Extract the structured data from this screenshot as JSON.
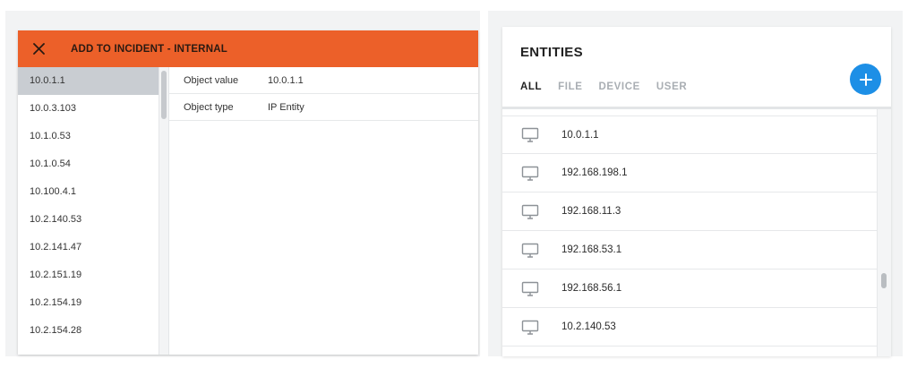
{
  "modal": {
    "title": "ADD TO INCIDENT - INTERNAL",
    "header_color": "#ec6029",
    "close_icon": "close-icon"
  },
  "ip_list": [
    "10.0.1.1",
    "10.0.3.103",
    "10.1.0.53",
    "10.1.0.54",
    "10.100.4.1",
    "10.2.140.53",
    "10.2.141.47",
    "10.2.151.19",
    "10.2.154.19",
    "10.2.154.28"
  ],
  "selected_ip": "10.0.1.1",
  "details": [
    {
      "label": "Object value",
      "value": "10.0.1.1"
    },
    {
      "label": "Object type",
      "value": "IP Entity"
    }
  ],
  "entities": {
    "title": "ENTITIES",
    "tabs": [
      {
        "label": "ALL",
        "active": true
      },
      {
        "label": "FILE",
        "active": false
      },
      {
        "label": "DEVICE",
        "active": false
      },
      {
        "label": "USER",
        "active": false
      }
    ],
    "add_icon": "plus-icon",
    "add_button_color": "#1d8fe6",
    "items": [
      {
        "label": "10.0.1.1",
        "icon": "monitor-icon"
      },
      {
        "label": "192.168.198.1",
        "icon": "monitor-icon"
      },
      {
        "label": "192.168.11.3",
        "icon": "monitor-icon"
      },
      {
        "label": "192.168.53.1",
        "icon": "monitor-icon"
      },
      {
        "label": "192.168.56.1",
        "icon": "monitor-icon"
      },
      {
        "label": "10.2.140.53",
        "icon": "monitor-icon"
      }
    ]
  }
}
